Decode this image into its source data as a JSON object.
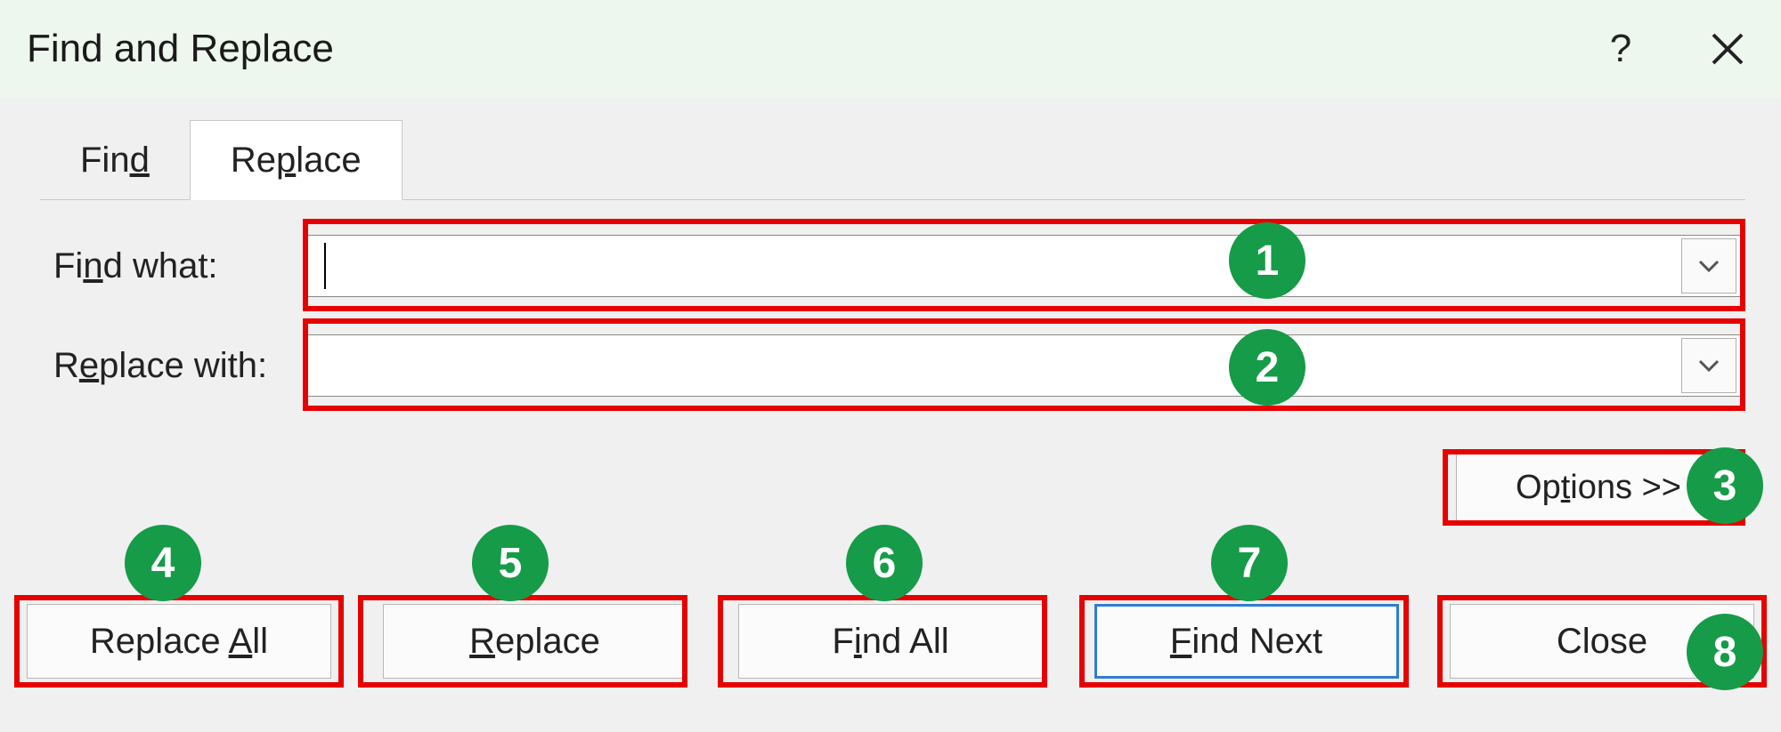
{
  "titlebar": {
    "title": "Find and Replace",
    "help_label": "?"
  },
  "tabs": {
    "find": {
      "pre": "Fin",
      "key": "d",
      "post": ""
    },
    "replace": {
      "pre": "Re",
      "key": "p",
      "post": "lace"
    }
  },
  "labels": {
    "find_what": {
      "pre": "Fi",
      "key": "n",
      "post": "d what:"
    },
    "replace_with": {
      "pre": "R",
      "key": "e",
      "post": "place with:"
    }
  },
  "fields": {
    "find_what_value": "",
    "replace_with_value": ""
  },
  "buttons": {
    "options": {
      "pre": "Op",
      "key": "t",
      "post": "ions >>"
    },
    "replace_all": {
      "pre": "Replace ",
      "key": "A",
      "post": "ll"
    },
    "replace": {
      "pre": "",
      "key": "R",
      "post": "eplace"
    },
    "find_all": {
      "pre": "F",
      "key": "i",
      "post": "nd All"
    },
    "find_next": {
      "pre": "",
      "key": "F",
      "post": "ind Next"
    },
    "close": {
      "pre": "Close",
      "key": "",
      "post": ""
    }
  },
  "annotations": {
    "1": "1",
    "2": "2",
    "3": "3",
    "4": "4",
    "5": "5",
    "6": "6",
    "7": "7",
    "8": "8"
  }
}
